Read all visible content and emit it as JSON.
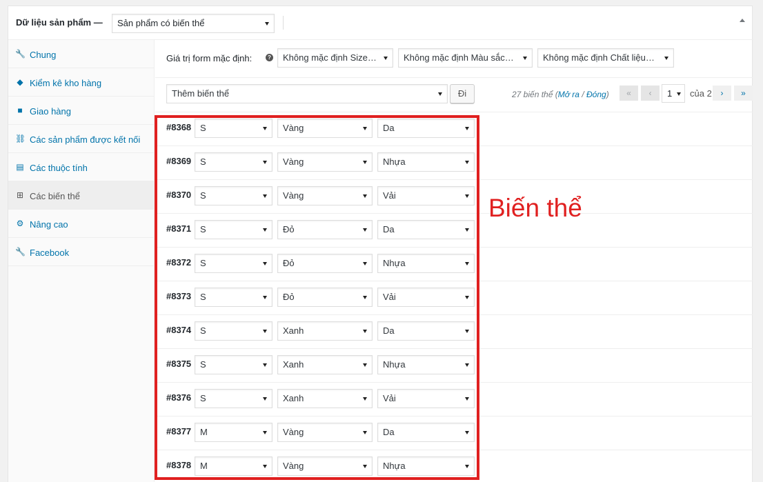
{
  "header": {
    "title": "Dữ liệu sản phẩm —",
    "product_type": "Sản phẩm có biến thể"
  },
  "sidebar": {
    "items": [
      {
        "label": "Chung",
        "icon": "wrench-icon",
        "glyph": "🔧"
      },
      {
        "label": "Kiểm kê kho hàng",
        "icon": "tag-icon",
        "glyph": "◆"
      },
      {
        "label": "Giao hàng",
        "icon": "truck-icon",
        "glyph": "■"
      },
      {
        "label": "Các sản phẩm được kết nối",
        "icon": "link-icon",
        "glyph": "⛓"
      },
      {
        "label": "Các thuộc tính",
        "icon": "list-icon",
        "glyph": "▤"
      },
      {
        "label": "Các biến thể",
        "icon": "grid-icon",
        "glyph": "⊞"
      },
      {
        "label": "Nâng cao",
        "icon": "gear-icon",
        "glyph": "⚙"
      },
      {
        "label": "Facebook",
        "icon": "wrench-icon",
        "glyph": "🔧"
      }
    ]
  },
  "defaults": {
    "label": "Giá trị form mặc định:",
    "help_glyph": "?",
    "size": "Không mặc định Size…",
    "color": "Không mặc định Màu sắc…",
    "material": "Không mặc định Chất liệu…"
  },
  "toolbar": {
    "bulk_action": "Thêm biến thể",
    "go_label": "Đi",
    "count_prefix": "27 biến thể (",
    "expand_label": "Mở ra",
    "slash": " / ",
    "collapse_label": "Đóng",
    "count_suffix": ")",
    "first": "«",
    "prev": "‹",
    "page": "1",
    "of_label": "của 2",
    "next": "›",
    "last": "»"
  },
  "variations": [
    {
      "id": "#8368",
      "size": "S",
      "color": "Vàng",
      "material": "Da"
    },
    {
      "id": "#8369",
      "size": "S",
      "color": "Vàng",
      "material": "Nhựa"
    },
    {
      "id": "#8370",
      "size": "S",
      "color": "Vàng",
      "material": "Vải"
    },
    {
      "id": "#8371",
      "size": "S",
      "color": "Đỏ",
      "material": "Da"
    },
    {
      "id": "#8372",
      "size": "S",
      "color": "Đỏ",
      "material": "Nhựa"
    },
    {
      "id": "#8373",
      "size": "S",
      "color": "Đỏ",
      "material": "Vải"
    },
    {
      "id": "#8374",
      "size": "S",
      "color": "Xanh",
      "material": "Da"
    },
    {
      "id": "#8375",
      "size": "S",
      "color": "Xanh",
      "material": "Nhựa"
    },
    {
      "id": "#8376",
      "size": "S",
      "color": "Xanh",
      "material": "Vải"
    },
    {
      "id": "#8377",
      "size": "M",
      "color": "Vàng",
      "material": "Da"
    },
    {
      "id": "#8378",
      "size": "M",
      "color": "Vàng",
      "material": "Nhựa"
    }
  ],
  "annotation": {
    "text": "Biến thể",
    "color": "#e02020"
  }
}
